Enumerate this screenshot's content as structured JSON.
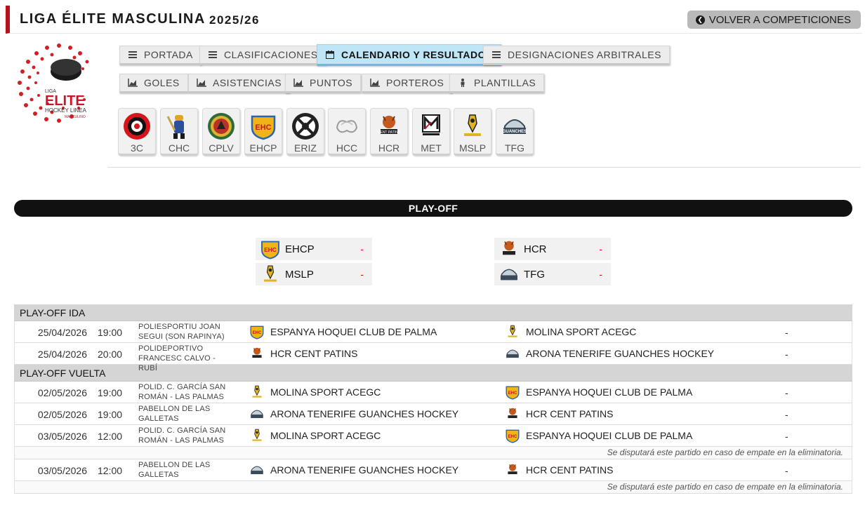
{
  "header": {
    "title": "LIGA ÉLITE MASCULINA",
    "season": "2025/26",
    "back_label": "VOLVER A COMPETICIONES"
  },
  "logo": {
    "top": "LIGA",
    "main": "ELITE",
    "sub1": "HOCKEY LINEA",
    "sub2": "MASCULINO"
  },
  "nav": {
    "row1": [
      {
        "label": "PORTADA",
        "icon": "list-icon"
      },
      {
        "label": "CLASIFICACIONES",
        "icon": "list-icon"
      },
      {
        "label": "CALENDARIO Y RESULTADOS",
        "icon": "calendar-icon",
        "active": true
      },
      {
        "label": "DESIGNACIONES ARBITRALES",
        "icon": "list-icon"
      }
    ],
    "row2": [
      {
        "label": "GOLES",
        "icon": "area-chart-icon"
      },
      {
        "label": "ASISTENCIAS",
        "icon": "area-chart-icon"
      },
      {
        "label": "PUNTOS",
        "icon": "area-chart-icon"
      },
      {
        "label": "PORTEROS",
        "icon": "area-chart-icon"
      },
      {
        "label": "PLANTILLAS",
        "icon": "person-icon"
      }
    ]
  },
  "teams": [
    {
      "abbr": "3C",
      "color": "#d6141c"
    },
    {
      "abbr": "CHC",
      "color": "#2a4f9c"
    },
    {
      "abbr": "CPLV",
      "color": "#b7332a"
    },
    {
      "abbr": "EHCP",
      "color": "#f0b418"
    },
    {
      "abbr": "ERIZ",
      "color": "#222222"
    },
    {
      "abbr": "HCC",
      "color": "#9a9a9a"
    },
    {
      "abbr": "HCR",
      "color": "#c45a1e"
    },
    {
      "abbr": "MET",
      "color": "#1b1b1b"
    },
    {
      "abbr": "MSLP",
      "color": "#e1b31f"
    },
    {
      "abbr": "TFG",
      "color": "#3a4a5a"
    }
  ],
  "playoff": {
    "title": "PLAY-OFF",
    "bracket": [
      {
        "name": "EHCP",
        "score": "-"
      },
      {
        "name": "MSLP",
        "score": "-"
      },
      {
        "name": "HCR",
        "score": "-"
      },
      {
        "name": "TFG",
        "score": "-"
      }
    ]
  },
  "sections": [
    {
      "title": "PLAY-OFF IDA",
      "matches": [
        {
          "date": "25/04/2026",
          "time": "19:00",
          "venue1": "POLIESPORTIU JOAN",
          "venue2": "SEGUI (SON RAPINYA)",
          "home": "ESPANYA HOQUEI CLUB DE PALMA",
          "away": "MOLINA SPORT ACEGC",
          "result": "-"
        },
        {
          "date": "25/04/2026",
          "time": "20:00",
          "venue1": "POLIDEPORTIVO",
          "venue2": "FRANCESC CALVO - RUBÍ",
          "home": "HCR CENT PATINS",
          "away": "ARONA TENERIFE GUANCHES HOCKEY",
          "result": "-"
        }
      ]
    },
    {
      "title": "PLAY-OFF VUELTA",
      "matches": [
        {
          "date": "02/05/2026",
          "time": "19:00",
          "venue1": "POLID. C. GARCÍA SAN",
          "venue2": "ROMÁN - LAS PALMAS",
          "home": "MOLINA SPORT ACEGC",
          "away": "ESPANYA HOQUEI CLUB DE PALMA",
          "result": "-"
        },
        {
          "date": "02/05/2026",
          "time": "19:00",
          "venue1": "PABELLON DE LAS",
          "venue2": "GALLETAS",
          "home": "ARONA TENERIFE GUANCHES HOCKEY",
          "away": "HCR CENT PATINS",
          "result": "-"
        },
        {
          "date": "03/05/2026",
          "time": "12:00",
          "venue1": "POLID. C. GARCÍA SAN",
          "venue2": "ROMÁN - LAS PALMAS",
          "home": "MOLINA SPORT ACEGC",
          "away": "ESPANYA HOQUEI CLUB DE PALMA",
          "result": "-",
          "note": "Se disputará este partido en caso de empate en la eliminatoria."
        },
        {
          "date": "03/05/2026",
          "time": "12:00",
          "venue1": "PABELLON DE LAS",
          "venue2": "GALLETAS",
          "home": "ARONA TENERIFE GUANCHES HOCKEY",
          "away": "HCR CENT PATINS",
          "result": "-",
          "note": "Se disputará este partido en caso de empate en la eliminatoria."
        }
      ]
    }
  ]
}
